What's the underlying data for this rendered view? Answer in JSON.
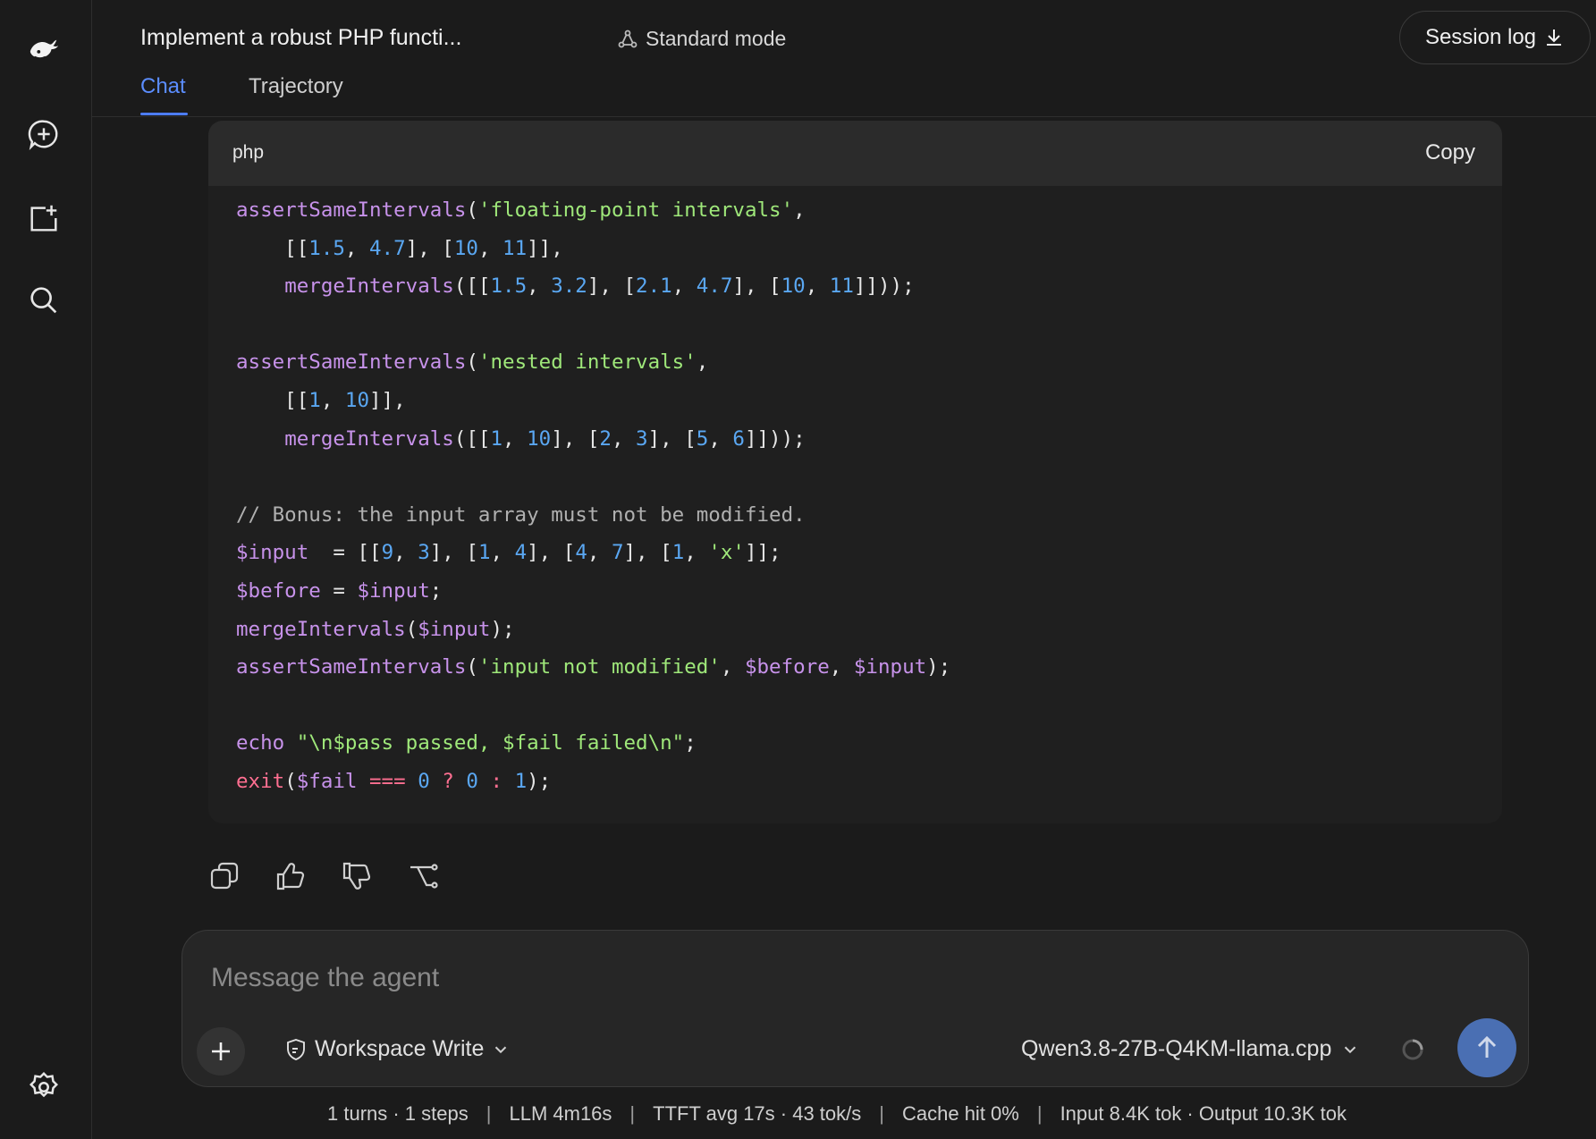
{
  "header": {
    "title": "Implement a robust PHP functi...",
    "mode": "Standard mode",
    "session_log": "Session log",
    "tabs": [
      {
        "label": "Chat",
        "active": true
      },
      {
        "label": "Trajectory",
        "active": false
      }
    ]
  },
  "sidebar": {
    "icons": [
      "logo-whale-icon",
      "new-chat-icon",
      "new-folder-icon",
      "search-icon",
      "settings-icon"
    ]
  },
  "code": {
    "language": "php",
    "copy_label": "Copy",
    "lines": [
      "assertSameIntervals('floating-point intervals',",
      "    [[1.5, 4.7], [10, 11]],",
      "    mergeIntervals([[1.5, 3.2], [2.1, 4.7], [10, 11]]));",
      "",
      "assertSameIntervals('nested intervals',",
      "    [[1, 10]],",
      "    mergeIntervals([[1, 10], [2, 3], [5, 6]]));",
      "",
      "// Bonus: the input array must not be modified.",
      "$input  = [[9, 3], [1, 4], [4, 7], [1, 'x']];",
      "$before = $input;",
      "mergeIntervals($input);",
      "assertSameIntervals('input not modified', $before, $input);",
      "",
      "echo \"\\n$pass passed, $fail failed\\n\";",
      "exit($fail === 0 ? 0 : 1);"
    ]
  },
  "composer": {
    "placeholder": "Message the agent",
    "permission": "Workspace Write",
    "model": "Qwen3.8-27B-Q4KM-llama.cpp"
  },
  "status": {
    "turns": "1 turns · 1 steps",
    "llm": "LLM 4m16s",
    "ttft": "TTFT avg 17s · 43 tok/s",
    "cache": "Cache hit 0%",
    "tokens": "Input 8.4K tok · Output 10.3K tok"
  },
  "colors": {
    "accent": "#4d7dff",
    "send_button": "#4a6fb3",
    "code_function": "#c792ea",
    "code_string": "#9fe87a",
    "code_number": "#5aa7f2",
    "code_keyword": "#ff6f91"
  }
}
